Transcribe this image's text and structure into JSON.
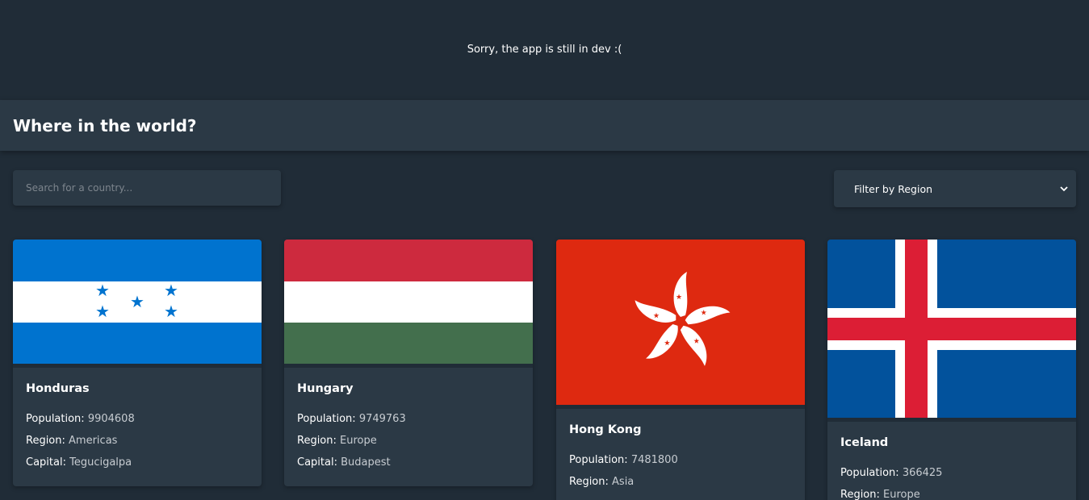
{
  "notice": {
    "text": "Sorry, the app is still in dev :("
  },
  "header": {
    "title": "Where in the world?"
  },
  "search": {
    "placeholder": "Search for a country..."
  },
  "filter": {
    "selected": "Filter by Region",
    "icon": "chevron-down-icon"
  },
  "labels": {
    "population": "Population:",
    "region": "Region:",
    "capital": "Capital:"
  },
  "countries": [
    {
      "name": "Honduras",
      "population": "9904608",
      "region": "Americas",
      "capital": "Tegucigalpa",
      "flag": "honduras-flag"
    },
    {
      "name": "Hungary",
      "population": "9749763",
      "region": "Europe",
      "capital": "Budapest",
      "flag": "hungary-flag"
    },
    {
      "name": "Hong Kong",
      "population": "7481800",
      "region": "Asia",
      "capital": "",
      "flag": "hong-kong-flag"
    },
    {
      "name": "Iceland",
      "population": "366425",
      "region": "Europe",
      "capital": "",
      "flag": "iceland-flag"
    }
  ],
  "colors": {
    "background": "#202c37",
    "element": "#2b3945",
    "text": "#ffffff"
  }
}
